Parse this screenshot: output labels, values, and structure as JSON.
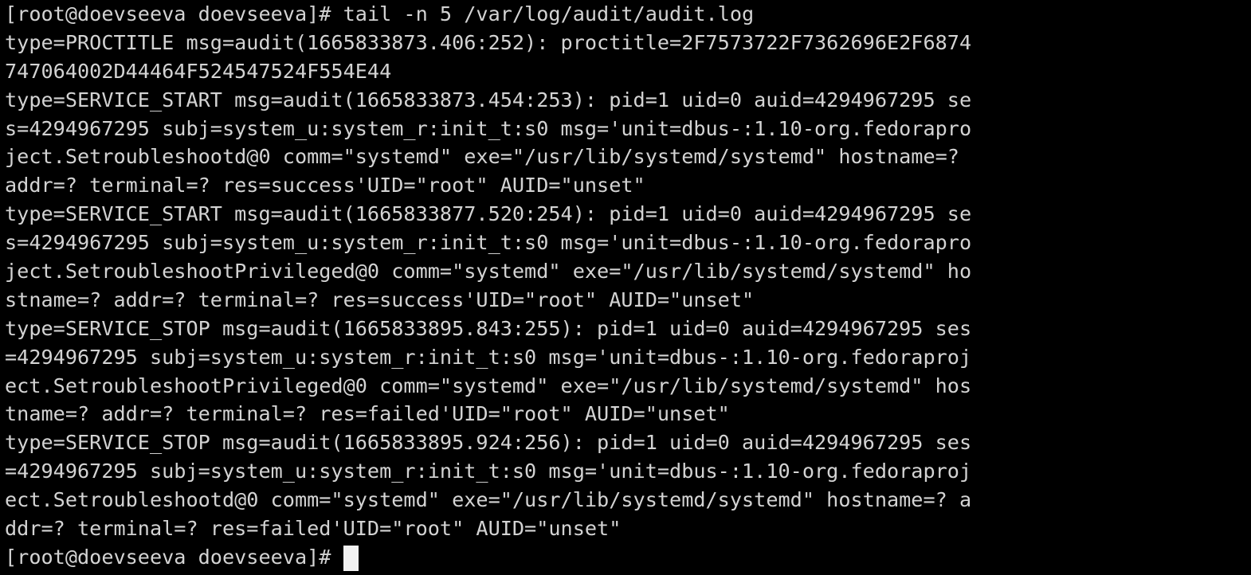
{
  "terminal": {
    "prompt": "[root@doevseeva doevseeva]# ",
    "command": "tail -n 5 /var/log/audit/audit.log",
    "output_lines": [
      "type=PROCTITLE msg=audit(1665833873.406:252): proctitle=2F7573722F7362696E2F6874",
      "747064002D44464F524547524F554E44",
      "type=SERVICE_START msg=audit(1665833873.454:253): pid=1 uid=0 auid=4294967295 se",
      "s=4294967295 subj=system_u:system_r:init_t:s0 msg='unit=dbus-:1.10-org.fedorapro",
      "ject.Setroubleshootd@0 comm=\"systemd\" exe=\"/usr/lib/systemd/systemd\" hostname=?",
      "addr=? terminal=? res=success'UID=\"root\" AUID=\"unset\"",
      "type=SERVICE_START msg=audit(1665833877.520:254): pid=1 uid=0 auid=4294967295 se",
      "s=4294967295 subj=system_u:system_r:init_t:s0 msg='unit=dbus-:1.10-org.fedorapro",
      "ject.SetroubleshootPrivileged@0 comm=\"systemd\" exe=\"/usr/lib/systemd/systemd\" ho",
      "stname=? addr=? terminal=? res=success'UID=\"root\" AUID=\"unset\"",
      "type=SERVICE_STOP msg=audit(1665833895.843:255): pid=1 uid=0 auid=4294967295 ses",
      "=4294967295 subj=system_u:system_r:init_t:s0 msg='unit=dbus-:1.10-org.fedoraproj",
      "ect.SetroubleshootPrivileged@0 comm=\"systemd\" exe=\"/usr/lib/systemd/systemd\" hos",
      "tname=? addr=? terminal=? res=failed'UID=\"root\" AUID=\"unset\"",
      "type=SERVICE_STOP msg=audit(1665833895.924:256): pid=1 uid=0 auid=4294967295 ses",
      "=4294967295 subj=system_u:system_r:init_t:s0 msg='unit=dbus-:1.10-org.fedoraproj",
      "ect.Setroubleshootd@0 comm=\"systemd\" exe=\"/usr/lib/systemd/systemd\" hostname=? a",
      "ddr=? terminal=? res=failed'UID=\"root\" AUID=\"unset\""
    ],
    "final_prompt": "[root@doevseeva doevseeva]# "
  },
  "colors": {
    "background": "#000000",
    "foreground": "#d3d3d3",
    "cursor": "#f2f2f2"
  }
}
